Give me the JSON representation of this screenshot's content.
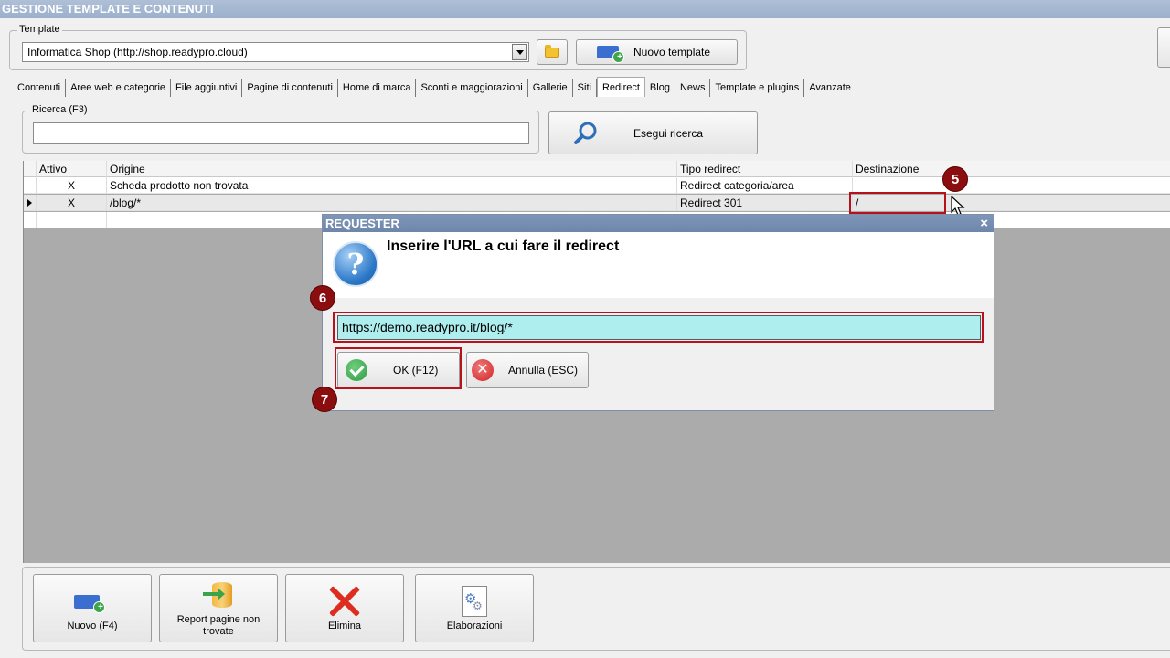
{
  "window": {
    "title": "GESTIONE TEMPLATE E CONTENUTI"
  },
  "template_group": {
    "label": "Template",
    "selected": "Informatica Shop (http://shop.readypro.cloud)",
    "new_button": "Nuovo template"
  },
  "tabs": [
    {
      "label": "Contenuti",
      "active": false
    },
    {
      "label": "Aree web e categorie",
      "active": false
    },
    {
      "label": "File aggiuntivi",
      "active": false
    },
    {
      "label": "Pagine di contenuti",
      "active": false
    },
    {
      "label": "Home di marca",
      "active": false
    },
    {
      "label": "Sconti e maggiorazioni",
      "active": false
    },
    {
      "label": "Gallerie",
      "active": false
    },
    {
      "label": "Siti",
      "active": false
    },
    {
      "label": "Redirect",
      "active": true
    },
    {
      "label": "Blog",
      "active": false
    },
    {
      "label": "News",
      "active": false
    },
    {
      "label": "Template e plugins",
      "active": false
    },
    {
      "label": "Avanzate",
      "active": false
    }
  ],
  "search": {
    "label": "Ricerca (F3)",
    "value": "",
    "button": "Esegui ricerca"
  },
  "grid": {
    "columns": [
      "Attivo",
      "Origine",
      "Tipo redirect",
      "Destinazione"
    ],
    "rows": [
      {
        "attivo": "X",
        "origine": "Scheda prodotto non trovata",
        "tipo": "Redirect categoria/area",
        "destinazione": ""
      },
      {
        "attivo": "X",
        "origine": "/blog/*",
        "tipo": "Redirect 301",
        "destinazione": "/"
      }
    ]
  },
  "markers": {
    "m5": "5",
    "m6": "6",
    "m7": "7"
  },
  "dialog": {
    "title": "REQUESTER",
    "close": "×",
    "message": "Inserire l'URL a cui fare il redirect",
    "input_value": "https://demo.readypro.it/blog/*",
    "ok_label": "OK (F12)",
    "cancel_label": "Annulla (ESC)"
  },
  "bottom_buttons": {
    "nuovo": "Nuovo (F4)",
    "report": "Report pagine non trovate",
    "elimina": "Elimina",
    "elaborazioni": "Elaborazioni"
  },
  "colors": {
    "highlight_red": "#b5121b",
    "marker": "#8a0e10",
    "input_cyan": "#aeeeee",
    "dialog_title": "#6d86aa"
  }
}
